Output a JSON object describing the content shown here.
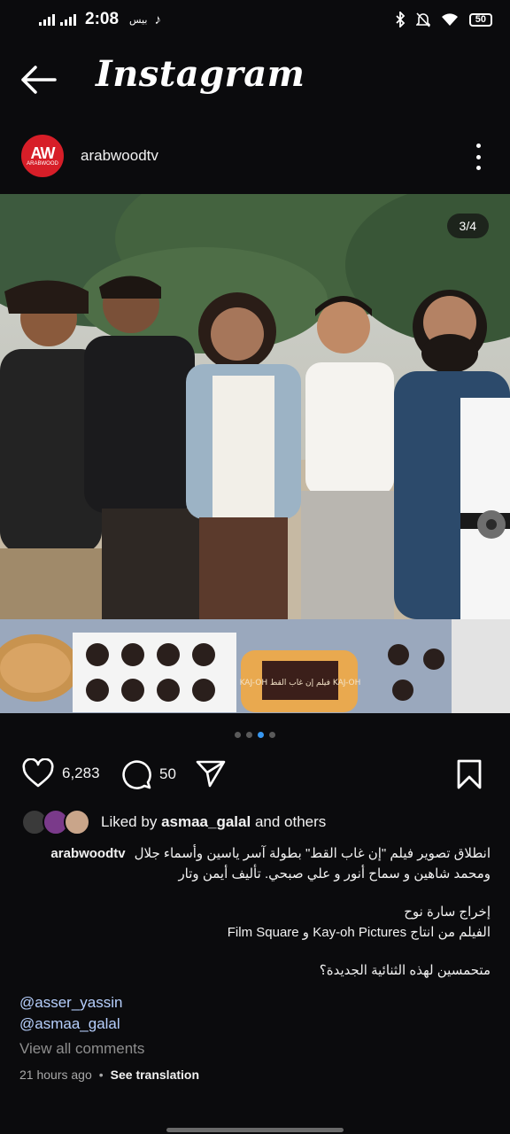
{
  "status_bar": {
    "time": "2:08",
    "carrier": "بيس",
    "battery": "50"
  },
  "header": {
    "title": "Instagram"
  },
  "post": {
    "username": "arabwoodtv",
    "avatar_text": "AW",
    "avatar_subtext": "ARABWOOD",
    "image_counter": "3/4",
    "image_index": 3,
    "image_total": 4,
    "cake_text": "KAJ-OH فيلم إن غاب القط KAJ-OH",
    "likes": "6,283",
    "comments": "50",
    "liked_by_prefix": "Liked by",
    "liked_by_user": "asmaa_galal",
    "liked_by_suffix": "and others",
    "caption": {
      "user": "arabwoodtv",
      "line1": "انطلاق تصوير فيلم \"إن غاب القط\" بطولة آسر ياسين وأسماء جلال",
      "line2": "ومحمد شاهين و سماح أنور و علي صبحي.  تأليف أيمن وتار",
      "line3": "إخراج سارة نوح",
      "line4": "الفيلم من انتاج Kay-oh Pictures و Film Square",
      "line5": "متحمسين لهذه الثنائية الجديدة؟"
    },
    "mentions": [
      "@asser_yassin",
      "@asmaa_galal"
    ],
    "view_comments": "View all comments",
    "time_ago": "21 hours ago",
    "see_translation": "See translation"
  },
  "colors": {
    "background": "#0b0b0d",
    "accent": "#3797f0",
    "mention": "#b6cffd",
    "brand_red": "#d71e28"
  }
}
